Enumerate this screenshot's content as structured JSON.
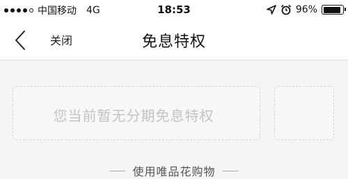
{
  "status_bar": {
    "carrier": "中国移动",
    "network": "4G",
    "time": "18:53",
    "battery_percent": "96%",
    "battery_level": 0.96,
    "icons": [
      "signal-dots-icon",
      "location-arrow-icon",
      "alarm-clock-icon",
      "battery-icon"
    ]
  },
  "nav": {
    "back_icon": "chevron-left-icon",
    "close_label": "关闭",
    "title": "免息特权"
  },
  "card": {
    "empty_message": "您当前暂无分期免息特权"
  },
  "footer": {
    "hint": "使用唯品花购物"
  }
}
